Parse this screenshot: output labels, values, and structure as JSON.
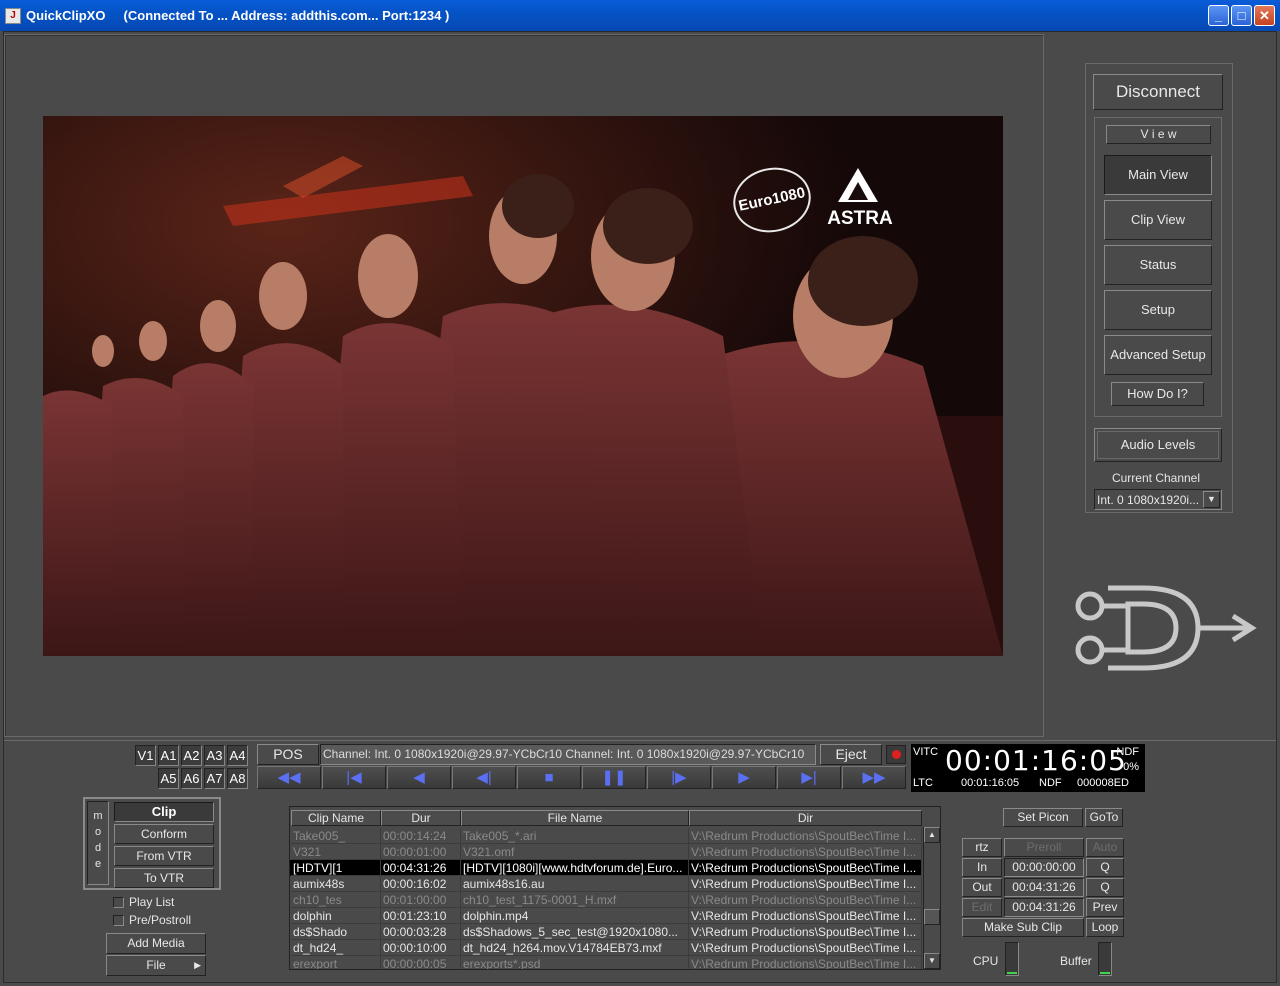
{
  "window": {
    "app_name": "QuickClipXO",
    "connection": "(Connected To ... Address: addthis.com... Port:1234  )",
    "icon_glyph": "J"
  },
  "video": {
    "logo_euro": "Euro1080",
    "logo_astra": "ASTRA"
  },
  "side": {
    "disconnect": "Disconnect",
    "view_label": "V i e w",
    "main_view": "Main View",
    "clip_view": "Clip View",
    "status": "Status",
    "setup": "Setup",
    "advanced_setup": "Advanced Setup",
    "how_do_i": "How Do I?",
    "audio_levels": "Audio Levels",
    "current_channel_label": "Current Channel",
    "current_channel_value": "Int. 0 1080x1920i..."
  },
  "tracks": {
    "row1": [
      "V1",
      "A1",
      "A2",
      "A3",
      "A4"
    ],
    "row2": [
      "A5",
      "A6",
      "A7",
      "A8"
    ]
  },
  "transport": {
    "pos_label": "POS",
    "channel_text": "Channel: Int. 0 1080x1920i@29.97-YCbCr10 Channel: Int. 0 1080x1920i@29.97-YCbCr10",
    "eject": "Eject",
    "buttons": [
      {
        "name": "rewind-icon",
        "glyph": "◀◀"
      },
      {
        "name": "skip-to-start-icon",
        "glyph": "|◀"
      },
      {
        "name": "step-back-icon",
        "glyph": "◀"
      },
      {
        "name": "back-icon",
        "glyph": "◀|"
      },
      {
        "name": "stop-icon",
        "glyph": "■"
      },
      {
        "name": "pause-icon",
        "glyph": "❚❚"
      },
      {
        "name": "forward-icon",
        "glyph": "|▶"
      },
      {
        "name": "play-icon",
        "glyph": "▶"
      },
      {
        "name": "skip-to-end-icon",
        "glyph": "▶|"
      },
      {
        "name": "fast-forward-icon",
        "glyph": "▶▶"
      }
    ]
  },
  "timecode": {
    "vitc_label": "VITC",
    "main": "00:01:16:05",
    "ndf_label": "NDF",
    "percent": "0%",
    "ltc_label": "LTC",
    "ltc_value": "00:01:16:05",
    "ltc_ndf": "NDF",
    "hex": "000008ED"
  },
  "mode": {
    "letters": [
      "m",
      "o",
      "d",
      "e"
    ],
    "items": [
      "Clip",
      "Conform",
      "From VTR",
      "To VTR"
    ],
    "play_list": "Play List",
    "pre_postroll": "Pre/Postroll",
    "add_media": "Add Media",
    "file": "File"
  },
  "grid": {
    "headers": [
      "Clip Name",
      "Dur",
      "File Name",
      "Dir"
    ],
    "rows": [
      {
        "clip": "Take005_",
        "dur": "00:00:14:24",
        "file": "Take005_*.ari",
        "dir": "V:\\Redrum Productions\\SpoutBec\\Time I...",
        "state": "dim"
      },
      {
        "clip": "V321",
        "dur": "00:00:01:00",
        "file": "V321.omf",
        "dir": "V:\\Redrum Productions\\SpoutBec\\Time I...",
        "state": "dim"
      },
      {
        "clip": "[HDTV][1",
        "dur": "00:04:31:26",
        "file": "[HDTV][1080i][www.hdtvforum.de].Euro...",
        "dir": "V:\\Redrum Productions\\SpoutBec\\Time I...",
        "state": "hl"
      },
      {
        "clip": "aumix48s",
        "dur": "00:00:16:02",
        "file": "aumix48s16.au",
        "dir": "V:\\Redrum Productions\\SpoutBec\\Time I...",
        "state": ""
      },
      {
        "clip": "ch10_tes",
        "dur": "00:01:00:00",
        "file": "ch10_test_1175-0001_H.mxf",
        "dir": "V:\\Redrum Productions\\SpoutBec\\Time I...",
        "state": "dim"
      },
      {
        "clip": "dolphin",
        "dur": "00:01:23:10",
        "file": "dolphin.mp4",
        "dir": "V:\\Redrum Productions\\SpoutBec\\Time I...",
        "state": ""
      },
      {
        "clip": "ds$Shado",
        "dur": "00:00:03:28",
        "file": "ds$Shadows_5_sec_test@1920x1080...",
        "dir": "V:\\Redrum Productions\\SpoutBec\\Time I...",
        "state": ""
      },
      {
        "clip": "dt_hd24_",
        "dur": "00:00:10:00",
        "file": "dt_hd24_h264.mov.V14784EB73.mxf",
        "dir": "V:\\Redrum Productions\\SpoutBec\\Time I...",
        "state": ""
      },
      {
        "clip": "erexport",
        "dur": "00:00:00:05",
        "file": "erexports*.psd",
        "dir": "V:\\Redrum Productions\\SpoutBec\\Time I...",
        "state": "dim"
      }
    ]
  },
  "marks": {
    "set_picon": "Set Picon",
    "goto": "GoTo",
    "rtz": "rtz",
    "preroll": "Preroll",
    "auto": "Auto",
    "in": "In",
    "in_value": "00:00:00:00",
    "q1": "Q",
    "out": "Out",
    "out_value": "00:04:31:26",
    "q2": "Q",
    "edit": "Edit",
    "edit_value": "00:04:31:26",
    "prev": "Prev",
    "make_sub_clip": "Make Sub Clip",
    "loop": "Loop"
  },
  "meters": {
    "cpu": "CPU",
    "buffer": "Buffer"
  },
  "colors": {
    "accent_blue": "#5b6ff2",
    "record_red": "#e02020",
    "meter_green": "#3fd24b"
  }
}
